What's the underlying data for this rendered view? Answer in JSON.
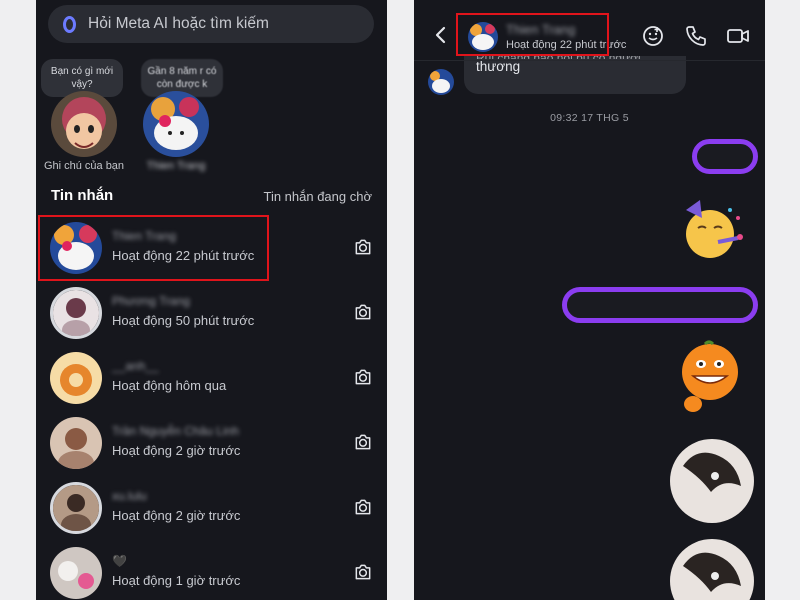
{
  "left": {
    "search": {
      "placeholder": "Hỏi Meta AI hoặc tìm kiếm"
    },
    "notes": [
      {
        "text": "Bạn có gì mới vậy?",
        "label": "Ghi chú của bạn"
      },
      {
        "text": "Gần 8 năm r có còn được k",
        "label": "Thien Trang"
      }
    ],
    "section_title": "Tin nhắn",
    "pending_label": "Tin nhắn đang chờ",
    "chats": [
      {
        "name": "Thien Trang",
        "status": "Hoạt động 22 phút trước"
      },
      {
        "name": "Phương Trang",
        "status": "Hoạt động 50 phút trước"
      },
      {
        "name": "__anh__",
        "status": "Hoạt động hôm qua"
      },
      {
        "name": "Trần Nguyễn Châu Linh",
        "status": "Hoạt động 2 giờ trước"
      },
      {
        "name": "xu.lulu",
        "status": "Hoạt động 2 giờ trước"
      },
      {
        "name": "🖤",
        "status": "Hoạt động 1 giờ trước"
      }
    ]
  },
  "right": {
    "header": {
      "name": "Thien Trang",
      "status": "Hoạt động 22 phút trước"
    },
    "incoming": {
      "line1": "Rủi chẳng nào nói bù cỏ người",
      "line2": "thương"
    },
    "timestamp": "09:32 17 THG 5"
  },
  "colors": {
    "highlight": "#e0141b",
    "redact": "#8b3df0",
    "background": "#16171d"
  }
}
